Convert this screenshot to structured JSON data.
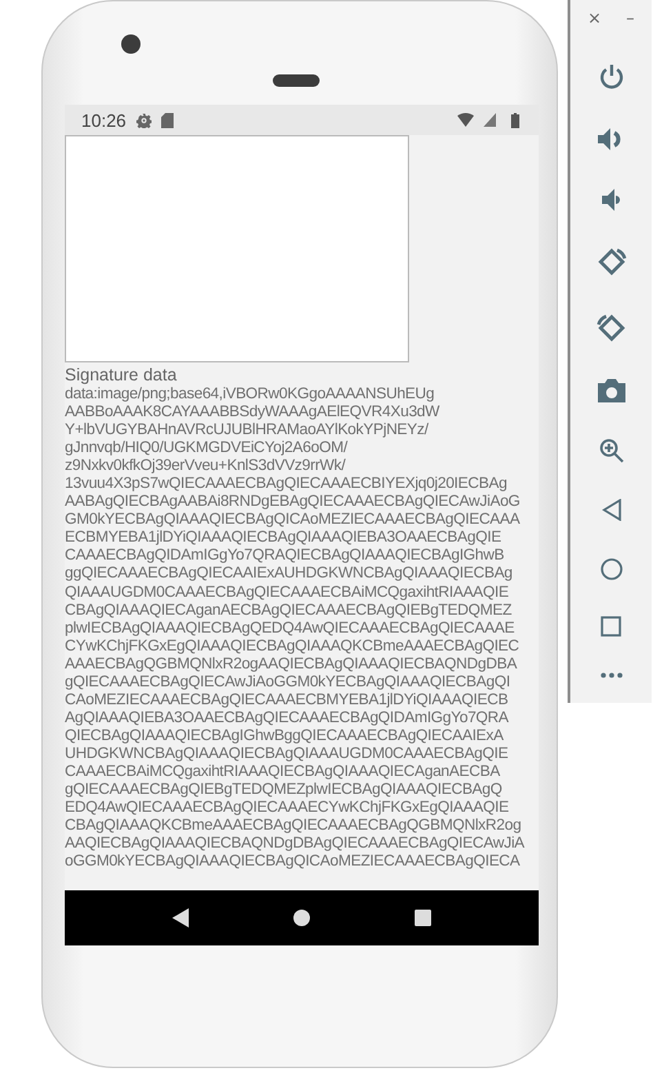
{
  "status_bar": {
    "time": "10:26"
  },
  "signature_label": "Signature data",
  "signature_data": "data:image/png;base64,iVBORw0KGgoAAAANSUhEUg\nAABBoAAAK8CAYAAABBSdyWAAAgAElEQVR4Xu3dW\nY+lbVUGYBAHnAVRcUJUBlHRAMaoAYlKokYPjNEYz/\ngJnnvqb/HIQ0/UGKMGDVEiCYoj2A6oOM/\nz9Nxkv0kfkOj39erVveu+KnlS3dVVz9rrWk/\n13vuu4X3pS7wQIECAAAECBAgQIECAAAECBIYEXjq0j20IECBAg\nAABAgQIECBAgAABAi8RNDgEBAgQIECAAAECBAgQIECAwJiAoG\nGM0kYECBAgQIAAAQIECBAgQICAoMEZIECAAAECBAgQIECAAA\nECBMYEBA1jlDYiQIAAAQIECBAgQIAAAQIEBA3OAAECBAgQIE\nCAAAECBAgQIDAmIGgYo7QRAQIECBAgQIAAAQIECBAgIGhwB\nggQIECAAAECBAgQIECAAIExAUHDGKWNCBAgQIAAAQIECBAg\nQIAAAUGDM0CAAAECBAgQIECAAAECBAiMCQgaxihtRIAAAQIE\nCBAgQIAAAQIECAganAECBAgQIECAAAECBAgQIEBgTEDQMEZ\nplwIECBAgQIAAAQIECBAgQEDQ4AwQIECAAAECBAgQIECAAAE\nCYwKChjFKGxEgQIAAAQIECBAgQIAAAQKCBmeAAAECBAgQIEC\nAAAECBAgQGBMQNlxR2ogAAQIECBAgQIAAAQIECBAQNDgDBA\ngQIECAAAECBAgQIECAwJiAoGGM0kYECBAgQIAAAQIECBAgQI\nCAoMEZIECAAAECBAgQIECAAAECBMYEBA1jlDYiQIAAAQIECB\nAgQIAAAQIEBA3OAAECBAgQIECAAAECBAgQIDAmIGgYo7QRA\nQIECBAgQIAAAQIECBAgIGhwBggQIECAAAECBAgQIECAAIExA\nUHDGKWNCBAgQIAAAQIECBAgQIAAAUGDM0CAAAECBAgQIE\nCAAAECBAiMCQgaxihtRIAAAQIECBAgQIAAAQIECAganAECBA\ngQIECAAAECBAgQIEBgTEDQMEZplwIECBAgQIAAAQIECBAgQ\nEDQ4AwQIECAAAECBAgQIECAAAECYwKChjFKGxEgQIAAAQIE\nCBAgQIAAAQKCBmeAAAECBAgQIECAAAECBAgQGBMQNlxR2og\nAAQIECBAgQIAAAQIECBAQNDgDBAgQIECAAAECBAgQIECAwJiA\noGGM0kYECBAgQIAAAQIECBAgQICAoMEZIECAAAECBAgQIECA",
  "emulator_toolbar": {
    "close": "×",
    "minimize": "–"
  }
}
